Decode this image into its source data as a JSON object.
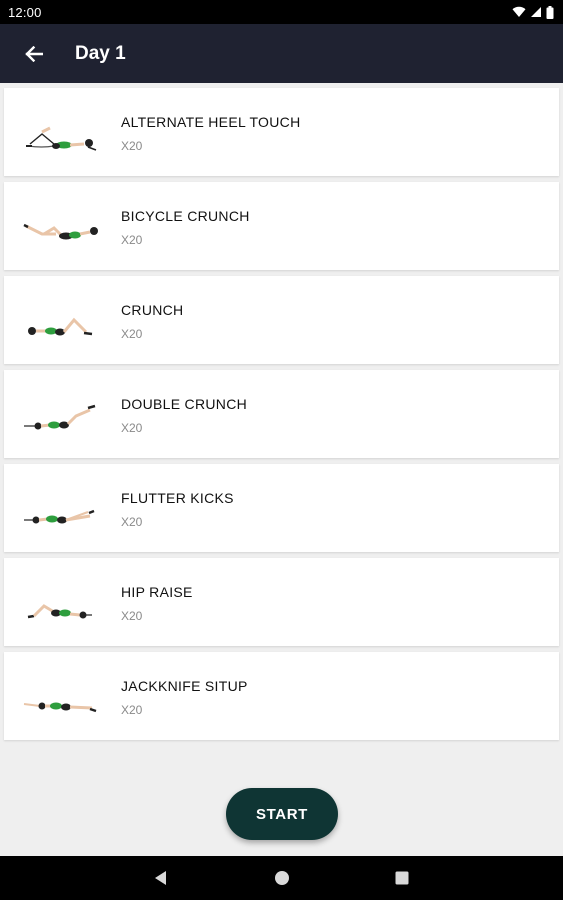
{
  "status_bar": {
    "time": "12:00"
  },
  "app_bar": {
    "title": "Day 1",
    "back_icon": "arrow-left-icon"
  },
  "exercises": [
    {
      "name": "ALTERNATE HEEL TOUCH",
      "reps": "X20"
    },
    {
      "name": "BICYCLE CRUNCH",
      "reps": "X20"
    },
    {
      "name": "CRUNCH",
      "reps": "X20"
    },
    {
      "name": "DOUBLE CRUNCH",
      "reps": "X20"
    },
    {
      "name": "FLUTTER KICKS",
      "reps": "X20"
    },
    {
      "name": "HIP RAISE",
      "reps": "X20"
    },
    {
      "name": "JACKKNIFE SITUP",
      "reps": "X20"
    }
  ],
  "start_button": {
    "label": "START"
  },
  "colors": {
    "app_bar": "#1f2231",
    "start_button": "#0f3534",
    "outfit": "#2e9e3e",
    "background": "#efefef"
  }
}
